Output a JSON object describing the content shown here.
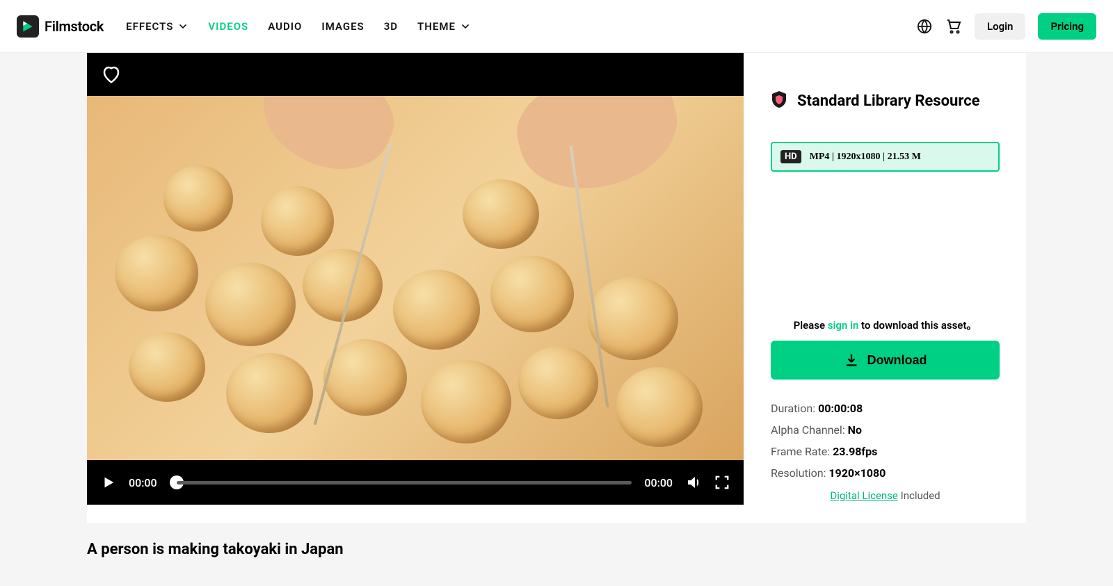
{
  "brand": "Filmstock",
  "nav": {
    "items": [
      {
        "label": "EFFECTS",
        "dropdown": true,
        "active": false
      },
      {
        "label": "VIDEOS",
        "dropdown": false,
        "active": true
      },
      {
        "label": "AUDIO",
        "dropdown": false,
        "active": false
      },
      {
        "label": "IMAGES",
        "dropdown": false,
        "active": false
      },
      {
        "label": "3D",
        "dropdown": false,
        "active": false
      },
      {
        "label": "THEME",
        "dropdown": true,
        "active": false
      }
    ]
  },
  "header": {
    "login": "Login",
    "pricing": "Pricing"
  },
  "player": {
    "current_time": "00:00",
    "total_time": "00:00"
  },
  "info": {
    "resource_title": "Standard Library Resource",
    "format": {
      "quality_badge": "HD",
      "line": "MP4 | 1920x1080 | 21.53 M"
    },
    "signin_prompt_pre": "Please ",
    "signin_link": "sign in",
    "signin_prompt_post": " to download this asset。",
    "download_label": "Download",
    "meta": {
      "duration_label": "Duration: ",
      "duration_value": "00:00:08",
      "alpha_label": "Alpha Channel: ",
      "alpha_value": "No",
      "fps_label": "Frame Rate: ",
      "fps_value": "23.98fps",
      "resolution_label": "Resolution: ",
      "resolution_value": "1920×1080"
    },
    "license_link": "Digital License",
    "license_suffix": " Included"
  },
  "video_title": "A person is making takoyaki in Japan"
}
